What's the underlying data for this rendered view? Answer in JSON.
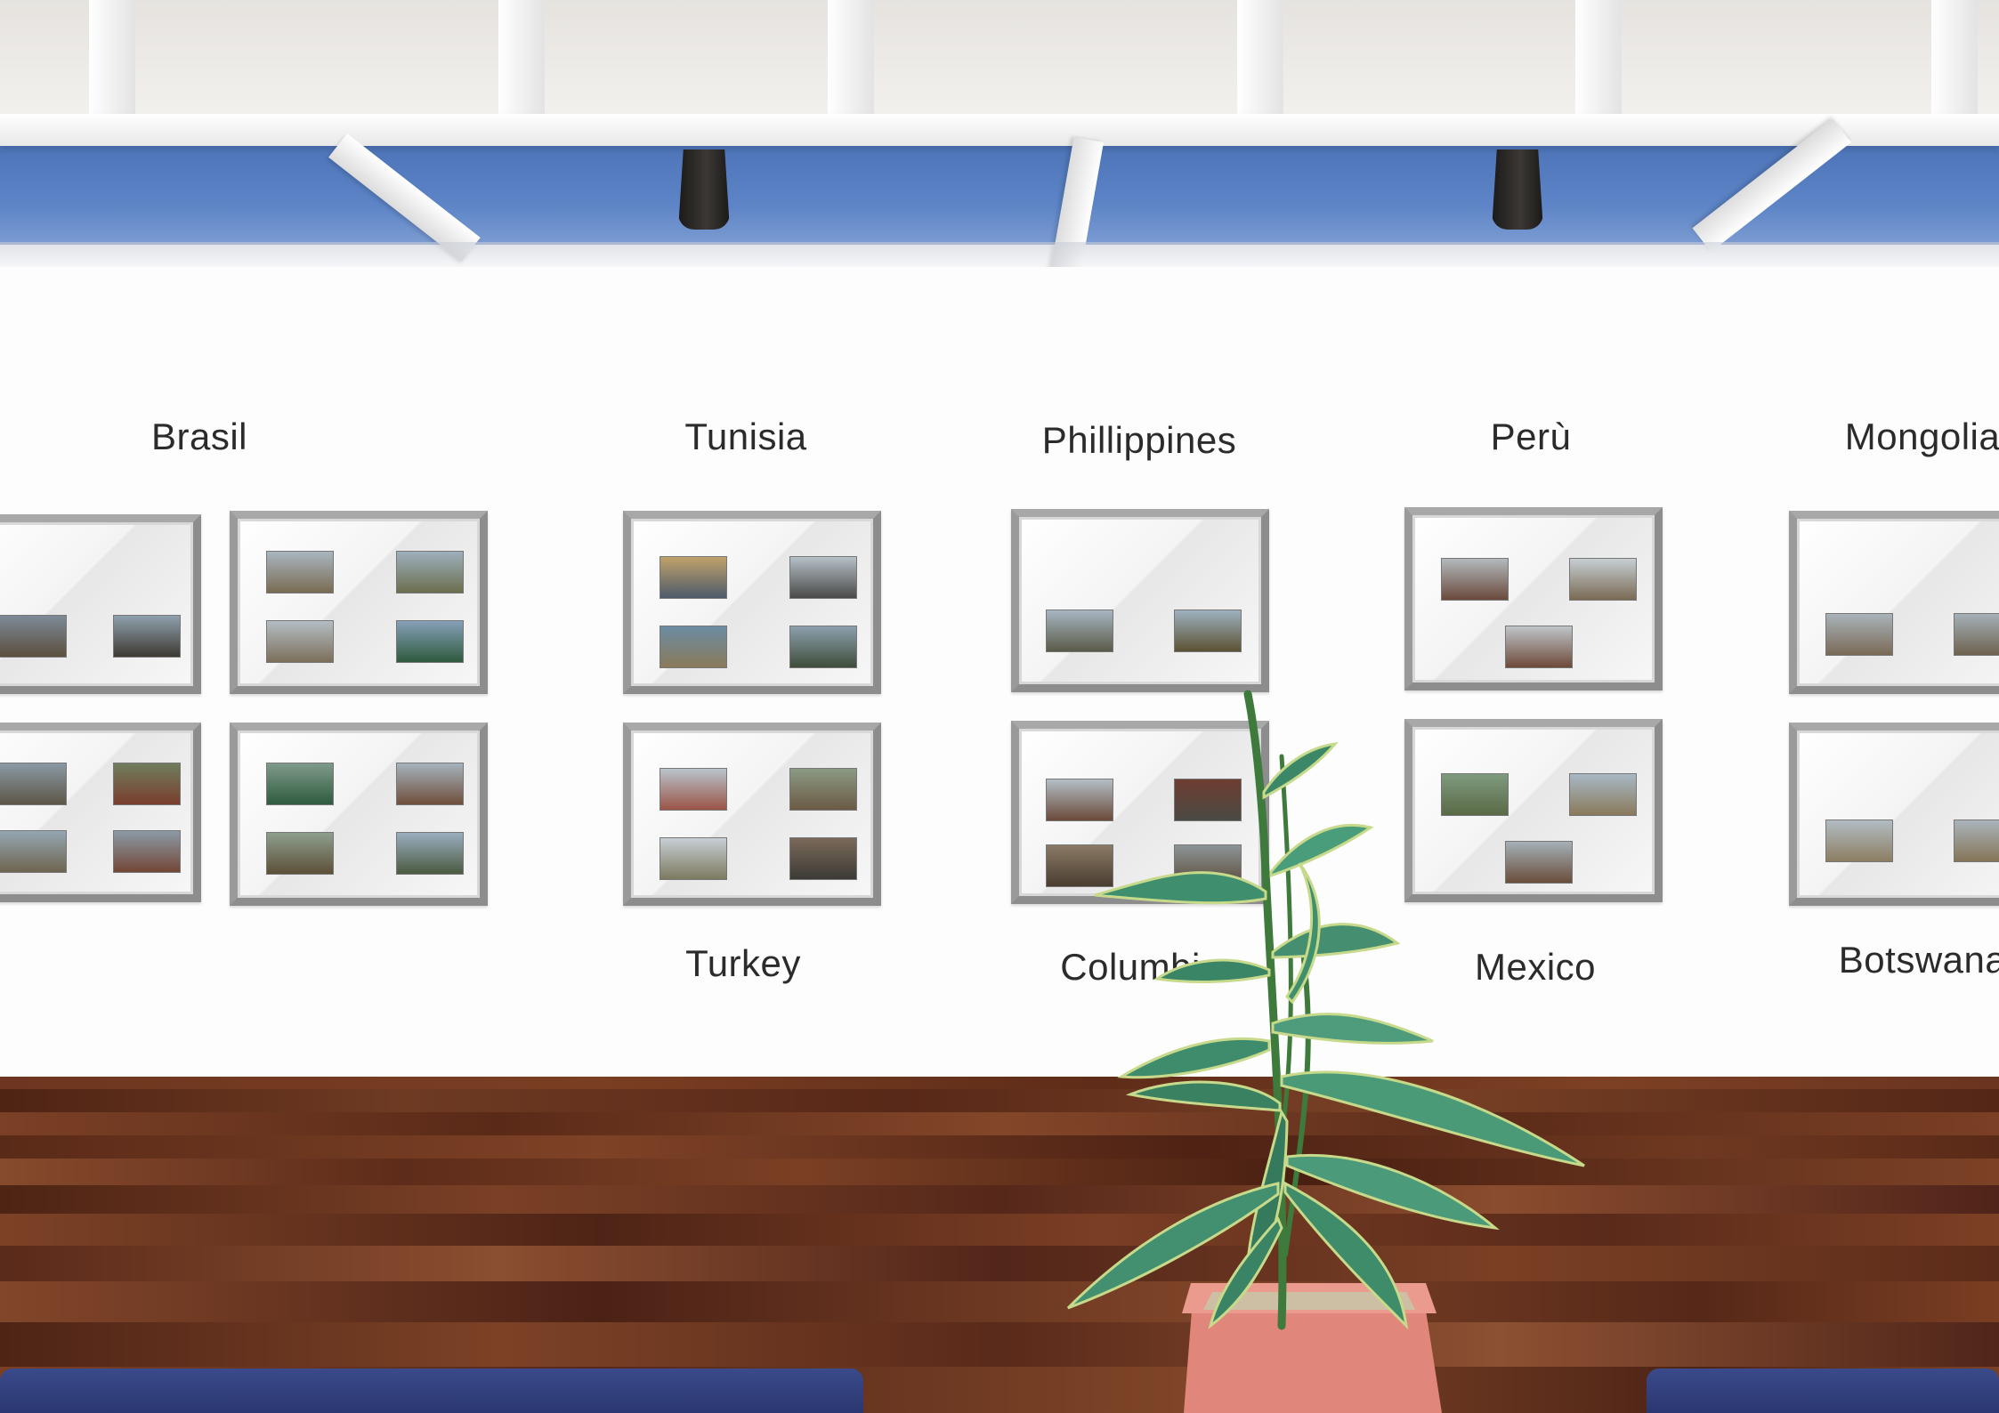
{
  "scene": {
    "colors": {
      "ceiling_blue": "#5c84c6",
      "wall": "#fdfdfd",
      "floor": "#5a2b17",
      "frame": "#8d8d8d",
      "bench": "#2e3b78",
      "pot": "#e0867a",
      "leaf": "#3f8f6e"
    }
  },
  "exhibits": [
    {
      "id": "brasil",
      "label": "Brasil"
    },
    {
      "id": "tunisia",
      "label": "Tunisia"
    },
    {
      "id": "philippines",
      "label": "Phillippines"
    },
    {
      "id": "peru",
      "label": "Perù"
    },
    {
      "id": "mongolia",
      "label": "Mongolia"
    },
    {
      "id": "turkey",
      "label": "Turkey"
    },
    {
      "id": "columbia",
      "label": "Columbia"
    },
    {
      "id": "mexico",
      "label": "Mexico"
    },
    {
      "id": "botswana",
      "label": "Botswana"
    }
  ],
  "objects": {
    "plant_icon": "potted-plant-icon",
    "lamp_icon": "ceiling-spotlight-icon"
  }
}
